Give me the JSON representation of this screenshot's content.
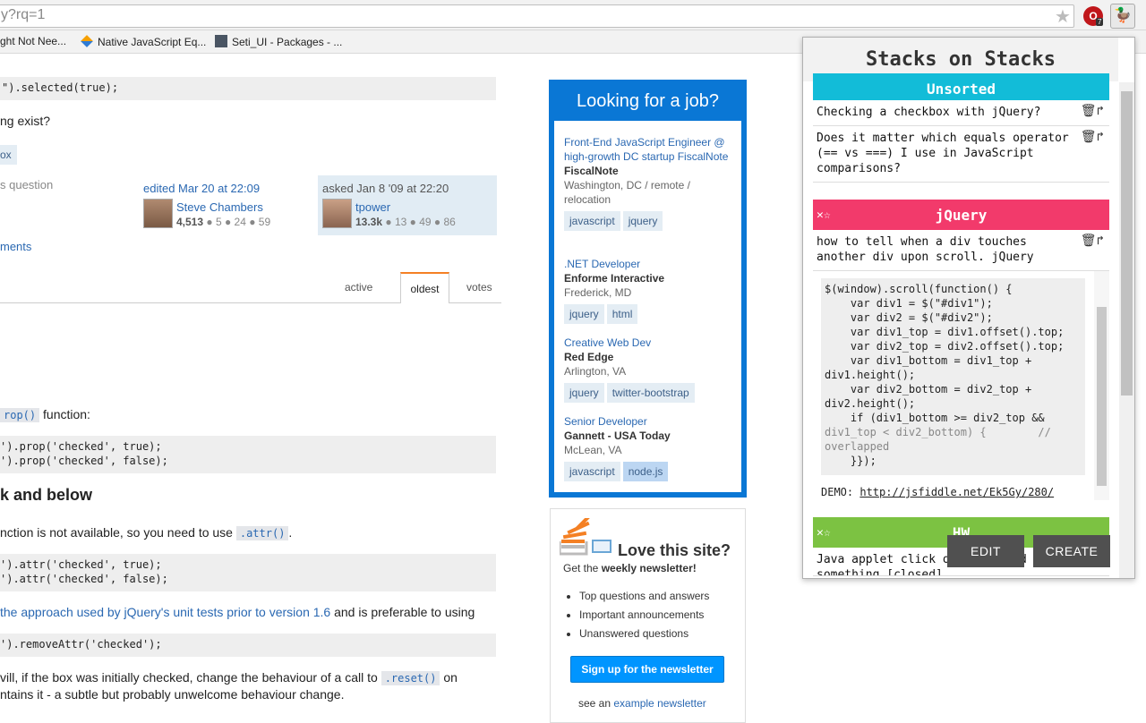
{
  "browser": {
    "url": "y?rq=1",
    "bookmarks": [
      "ght Not Nee...",
      "Native JavaScript Eq...",
      "Seti_UI - Packages - ..."
    ],
    "ext_badge": "7"
  },
  "question": {
    "code_top": "\").selected(true);",
    "text1": "ng exist?",
    "tag_fragment": "ox",
    "share_fragment": "s question",
    "edited": "edited Mar 20 at 22:09",
    "editor_name": "Steve Chambers",
    "editor_rep": "4,513",
    "editor_badges": "● 5 ● 24 ● 59",
    "asked": "asked Jan 8 '09 at 22:20",
    "asker_name": "tpower",
    "asker_rep": "13.3k",
    "asker_badges": "● 13 ● 49 ● 86",
    "comments": "ments"
  },
  "sort_tabs": [
    "active",
    "oldest",
    "votes"
  ],
  "answer": {
    "prop_code": "rop()",
    "prop_text": "function:",
    "code1": "').prop('checked', true);\n').prop('checked', false);",
    "heading": "k and below",
    "attr_text": "nction is not available, so you need to use",
    "attr_code": ".attr()",
    "code2": "').attr('checked', true);\n').attr('checked', false);",
    "approach_link": "the approach used by jQuery's unit tests prior to version 1.6",
    "approach_rest": "and is preferable to using",
    "code3": "').removeAttr('checked');",
    "will_text": "vill, if the box was initially checked, change the behaviour of a call to",
    "reset_code": ".reset()",
    "on_text": "on",
    "last_line": "ntains it - a subtle but probably unwelcome behaviour change."
  },
  "jobs": {
    "title": "Looking for a job?",
    "items": [
      {
        "title": "Front-End JavaScript Engineer @ high-growth DC startup FiscalNote",
        "company": "FiscalNote",
        "location": "Washington, DC / remote / relocation",
        "tags": [
          "javascript",
          "jquery"
        ]
      },
      {
        "title": ".NET Developer",
        "company": "Enforme Interactive",
        "location": "Frederick, MD",
        "tags": [
          "jquery",
          "html"
        ]
      },
      {
        "title": "Creative Web Dev",
        "company": "Red Edge",
        "location": "Arlington, VA",
        "tags": [
          "jquery",
          "twitter-bootstrap"
        ]
      },
      {
        "title": "Senior Developer",
        "company": "Gannett - USA Today",
        "location": "McLean, VA",
        "tags": [
          "javascript",
          "node.js"
        ]
      }
    ]
  },
  "newsletter": {
    "title": "Love this site?",
    "subtitle_pre": "Get the ",
    "subtitle_bold": "weekly newsletter!",
    "bullets": [
      "Top questions and answers",
      "Important announcements",
      "Unanswered questions"
    ],
    "button": "Sign up for the newsletter",
    "footer_pre": "see an ",
    "footer_link": "example newsletter"
  },
  "popup": {
    "title": "Stacks on Stacks",
    "stack_unsorted": {
      "name": "Unsorted",
      "color": "#12bcd8",
      "items": [
        "Checking a checkbox with jQuery?",
        "Does it matter which equals operator (== vs ===) I use in JavaScript comparisons?"
      ]
    },
    "stack_jquery": {
      "name": "jQuery",
      "color": "#f23a6b",
      "item": "how to tell when a div touches another div upon scroll. jQuery",
      "code_lines": [
        "$(window).scroll(function() {",
        "    var div1 = $(\"#div1\");",
        "    var div2 = $(\"#div2\");",
        "    var div1_top = div1.offset().top;",
        "    var div2_top = div2.offset().top;",
        "    var div1_bottom = div1_top +",
        "div1.height();",
        "    var div2_bottom = div2_top +",
        "div2.height();",
        "    if (div1_bottom >= div2_top &&",
        "div1_top < div2_bottom) {        //",
        "overlapped",
        "    }});"
      ],
      "demo_label": "DEMO:",
      "demo_link": "http://jsfiddle.net/Ek5Gy/280/"
    },
    "stack_hw": {
      "name": "HW",
      "color": "#7cc242",
      "item": "Java applet click on image and do something [closed]"
    },
    "edit_button": "EDIT",
    "create_button": "CREATE"
  }
}
